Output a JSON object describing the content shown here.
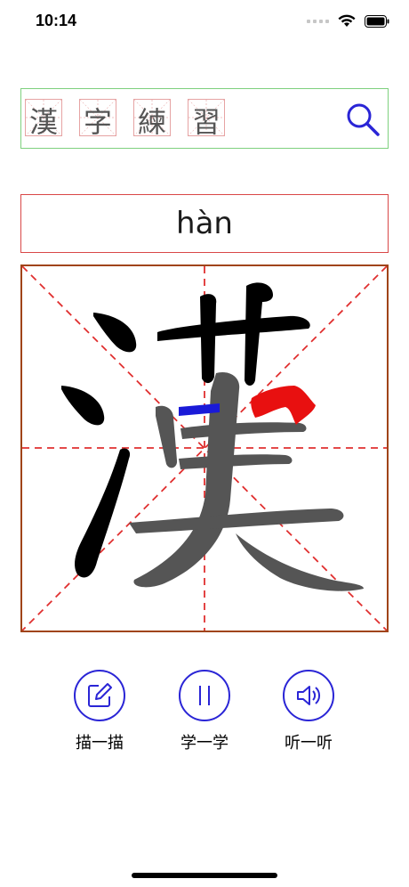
{
  "status_bar": {
    "time": "10:14"
  },
  "search": {
    "title_chars": [
      "漢",
      "字",
      "練",
      "習"
    ]
  },
  "character": {
    "hanzi": "漢",
    "pinyin": "hàn"
  },
  "actions": [
    {
      "label": "描一描",
      "icon": "edit-icon"
    },
    {
      "label": "学一学",
      "icon": "pause-icon"
    },
    {
      "label": "听一听",
      "icon": "speaker-icon"
    }
  ],
  "colors": {
    "accent": "#2a25d6",
    "search_border": "#7ed07e",
    "pinyin_border": "#d94848",
    "canvas_border": "#a04418",
    "guide_line": "#e03030",
    "stroke_done": "#000000",
    "stroke_pending": "#555555",
    "stroke_current": "#e81010",
    "stroke_hint": "#1a1ad8"
  }
}
